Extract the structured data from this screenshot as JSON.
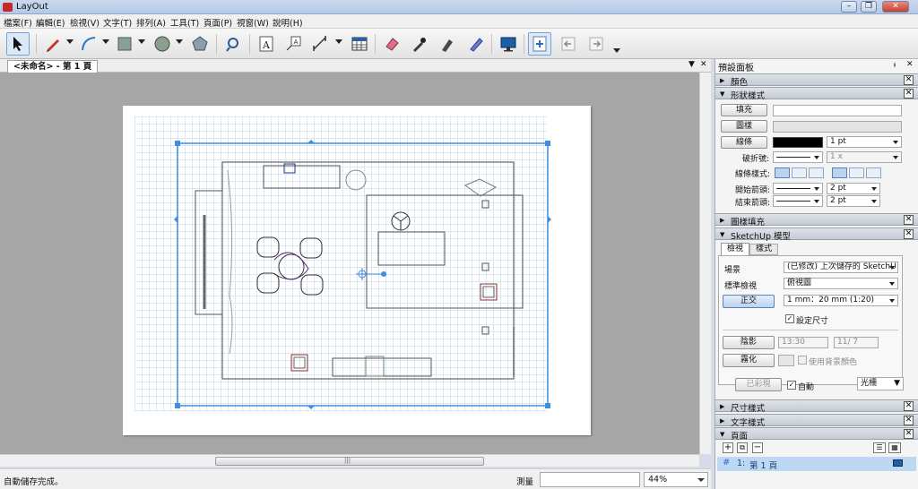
{
  "window": {
    "title": "LayOut",
    "minimize": "–",
    "restore": "❐",
    "close": "✕"
  },
  "menu": [
    "檔案(F)",
    "編輯(E)",
    "檢視(V)",
    "文字(T)",
    "排列(A)",
    "工具(T)",
    "頁面(P)",
    "視窗(W)",
    "說明(H)"
  ],
  "toolbar": {
    "tools": [
      "select-tool",
      "line-tool",
      "arc-tool",
      "rectangle-tool",
      "circle-tool",
      "polygon-tool",
      "offset-tool",
      "text-tool",
      "label-tool",
      "dimension-tool",
      "table-tool",
      "eraser-tool",
      "style-tool",
      "sample-tool",
      "split-tool",
      "presentation-tool",
      "add-page-tool",
      "previous-page-tool",
      "next-page-tool"
    ]
  },
  "doc_tab": {
    "label": "<未命名> - 第 1 頁",
    "close": "✕",
    "menu_arrow": "▼"
  },
  "status": {
    "message": "自動儲存完成。",
    "measure_label": "測量",
    "measure_value": "",
    "zoom": "44%"
  },
  "hscroll": {
    "grip": "|||"
  },
  "tray": {
    "title": "預設面板",
    "pin": "ᵼ",
    "close": "✕",
    "panels": {
      "colors": {
        "label": "顏色"
      },
      "shape_style": {
        "label": "形狀樣式",
        "fill_label": "填充",
        "pattern_label": "圖樣",
        "stroke_label": "線條",
        "stroke_width": "1 pt",
        "dash_label": "破折號:",
        "dash_scale": "1 x",
        "line_style_label": "線條樣式:",
        "start_arrow_label": "開始箭頭:",
        "start_arrow_size": "2 pt",
        "end_arrow_label": "結束箭頭:",
        "end_arrow_size": "2 pt",
        "stroke_color": "#000000"
      },
      "pattern_fill": {
        "label": "圖樣填充"
      },
      "sketchup_model": {
        "label": "SketchUp 模型",
        "tabs": [
          "檢視",
          "樣式"
        ],
        "scene_label": "場景",
        "scene_value": "(已修改) 上次儲存的 SketchU",
        "standard_view_label": "標準檢視",
        "standard_view_value": "俯視圖",
        "ortho_button": "正交",
        "scale_value": "1 mm：20 mm (1:20)",
        "preserve_scale_label": "設定尺寸",
        "preserve_scale_checked": true,
        "shadows_button": "陰影",
        "time_value": "13:30",
        "date_value": "11/ 7",
        "fog_button": "霧化",
        "use_bg_color_label": "使用背景顏色",
        "render_button": "已彩現",
        "auto_label": "自動",
        "auto_checked": true,
        "render_mode": "光柵"
      },
      "dimension_style": {
        "label": "尺寸樣式"
      },
      "text_style": {
        "label": "文字樣式"
      },
      "pages": {
        "label": "頁面",
        "items": [
          {
            "number": "1:",
            "name": "第 1 頁"
          }
        ]
      }
    }
  },
  "colors": {
    "accent": "#3d8ee0",
    "highlight": "#e01f1f",
    "selection": "#bcd8f2"
  }
}
